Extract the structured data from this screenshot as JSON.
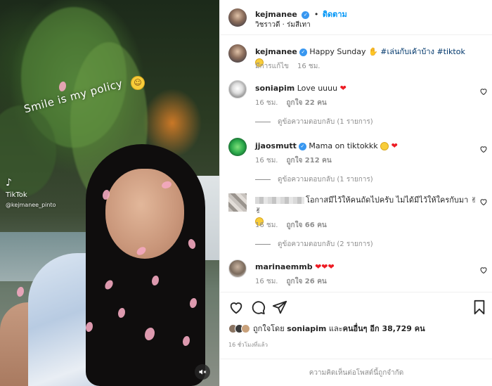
{
  "media": {
    "overlay_text": "Smile is my policy",
    "tiktok_logo": "TikTok",
    "tiktok_handle": "@kejmanee_pinto",
    "mute_icon": "speaker-muted-icon"
  },
  "header": {
    "username": "kejmanee",
    "follow_label": "ติดตาม",
    "location": "วิชราวดี · ร่มสีเทา"
  },
  "caption": {
    "username": "kejmanee",
    "text": "Happy Sunday",
    "hashtags": "#เล่นกับเค้าบ้าง #tiktok",
    "edited": "มีการแก้ไข",
    "time": "16 ชม."
  },
  "comments": [
    {
      "username": "soniapim",
      "text": "Love uuuu",
      "time": "16 ชม.",
      "likes": "ถูกใจ 22 คน",
      "replies": "ดูข้อความตอบกลับ (1 รายการ)"
    },
    {
      "username": "jjaosmutt",
      "text": "Mama on tiktokkk",
      "time": "16 ชม.",
      "likes": "ถูกใจ 212 คน",
      "replies": "ดูข้อความตอบกลับ (1 รายการ)"
    },
    {
      "username": "",
      "text": "โอกาสมีไว้ให้คนถัดไปครับ ไม่ได้มีไว้ให้ใครกับมา",
      "time": "16 ชม.",
      "likes": "ถูกใจ 66 คน",
      "replies": "ดูข้อความตอบกลับ (2 รายการ)"
    },
    {
      "username": "marinaemmb",
      "text": "",
      "time": "16 ชม.",
      "likes": "ถูกใจ 26 คน"
    }
  ],
  "likes": {
    "prefix": "ถูกใจโดย",
    "user": "soniapim",
    "middle": "และ",
    "others": "คนอื่นๆ อีก 38,729 คน"
  },
  "timestamp": "16 ชั่วโมงที่แล้ว",
  "comment_limit": "ความคิดเห็นต่อโพสต์นี้ถูกจำกัด",
  "colors": {
    "accent": "#0095f6",
    "verified": "#3897f0",
    "heart": "#ed1c24"
  }
}
